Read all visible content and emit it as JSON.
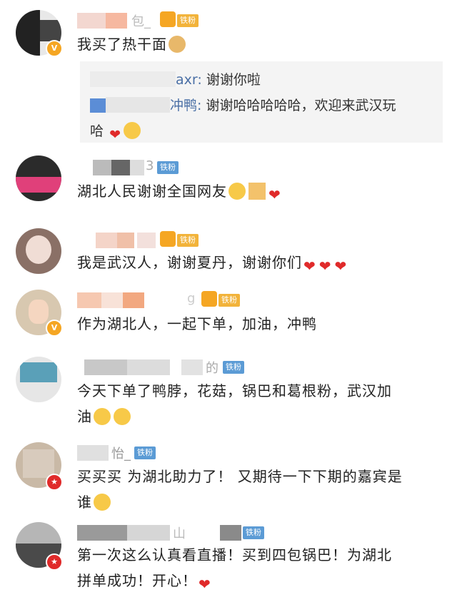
{
  "comments": [
    {
      "text": "我买了热干面",
      "badge": "铁粉"
    },
    {
      "text": "湖北人民谢谢全国网友",
      "badge": "铁粉",
      "name_suffix": "3"
    },
    {
      "text": "我是武汉人，谢谢夏丹，谢谢你们",
      "badge": "铁粉"
    },
    {
      "text": "作为湖北人，一起下单，加油，冲鸭",
      "badge": "铁粉",
      "name_suffix": "g"
    },
    {
      "text": "今天下单了鸭脖，花菇，锅巴和葛根粉，武汉加",
      "text2": "油",
      "badge": "铁粉",
      "name_suffix": "的"
    },
    {
      "text": "买买买 为湖北助力了！ 又期待一下下期的嘉宾是",
      "text2": "谁",
      "badge": "铁粉",
      "name_suffix": "怡_"
    },
    {
      "text": "第一次这么认真看直播！买到四包锅巴！为湖北",
      "text2": "拼单成功！开心！",
      "badge": "铁粉",
      "name_suffix": "山"
    }
  ],
  "replies": [
    {
      "user": "axr:",
      "text": "谢谢你啦"
    },
    {
      "user": "冲鸭:",
      "text": "谢谢哈哈哈哈哈，欢迎来武汉玩",
      "text2": "哈"
    }
  ],
  "first_name_fragment": "包_"
}
